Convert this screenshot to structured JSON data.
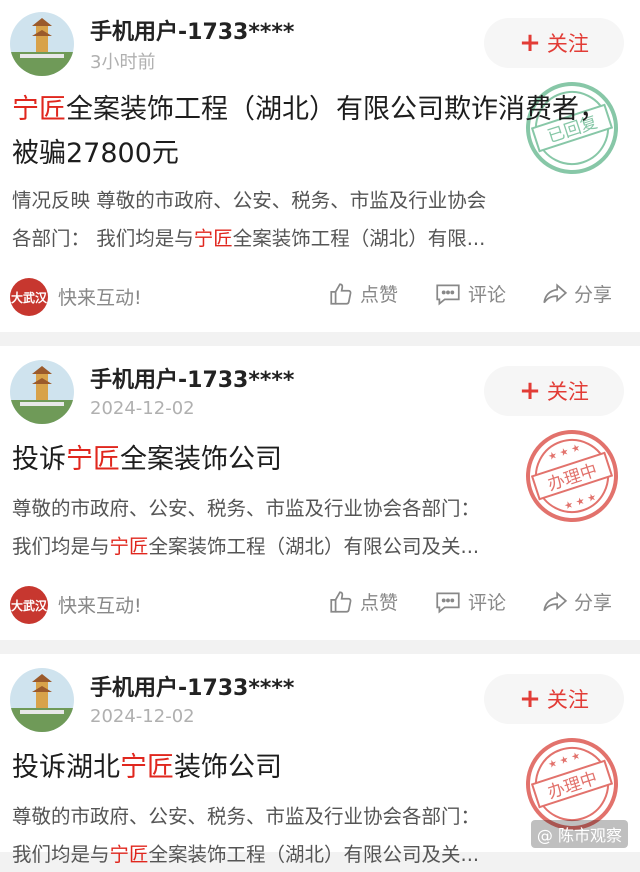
{
  "posts": [
    {
      "username": "手机用户-1733****",
      "time": "3小时前",
      "follow_label": "关注",
      "title_hl": "宁匠",
      "title_rest": "全案装饰工程（湖北）有限公司欺诈消费者，被骗27800元",
      "excerpt_line1": "情况反映 尊敬的市政府、公安、税务、市监及行业协会",
      "excerpt_line2_pre": "各部门： 我们均是与",
      "excerpt_line2_hl": "宁匠",
      "excerpt_line2_post": "全案装饰工程（湖北）有限...",
      "source": "快来互动!",
      "like": "点赞",
      "comment": "评论",
      "share": "分享",
      "stamp": "已回复",
      "stamp_color": "#5fb58a"
    },
    {
      "username": "手机用户-1733****",
      "time": "2024-12-02",
      "follow_label": "关注",
      "title_pre": "投诉",
      "title_hl": "宁匠",
      "title_rest": "全案装饰公司",
      "excerpt_line1": "尊敬的市政府、公安、税务、市监及行业协会各部门：",
      "excerpt_line2_pre": "我们均是与",
      "excerpt_line2_hl": "宁匠",
      "excerpt_line2_post": "全案装饰工程（湖北）有限公司及关...",
      "source": "快来互动!",
      "like": "点赞",
      "comment": "评论",
      "share": "分享",
      "stamp": "办理中",
      "stamp_color": "#d9443c"
    },
    {
      "username": "手机用户-1733****",
      "time": "2024-12-02",
      "follow_label": "关注",
      "title_pre": "投诉湖北",
      "title_hl": "宁匠",
      "title_rest": "装饰公司",
      "excerpt_line1": "尊敬的市政府、公安、税务、市监及行业协会各部门：",
      "excerpt_line2_pre": "我们均是与",
      "excerpt_line2_hl": "宁匠",
      "excerpt_line2_post": "全案装饰工程（湖北）有限公司及关...",
      "stamp": "办理中",
      "stamp_color": "#d9443c"
    }
  ],
  "source_logo_text": "大武汉",
  "watermark": "@ 陈市观察",
  "colors": {
    "accent": "#e0271e",
    "follow_bg": "#f6f6f6",
    "page_bg": "#f2f2f2"
  },
  "icons": [
    "thumbs-up-icon",
    "comment-icon",
    "share-icon",
    "plus-icon"
  ]
}
